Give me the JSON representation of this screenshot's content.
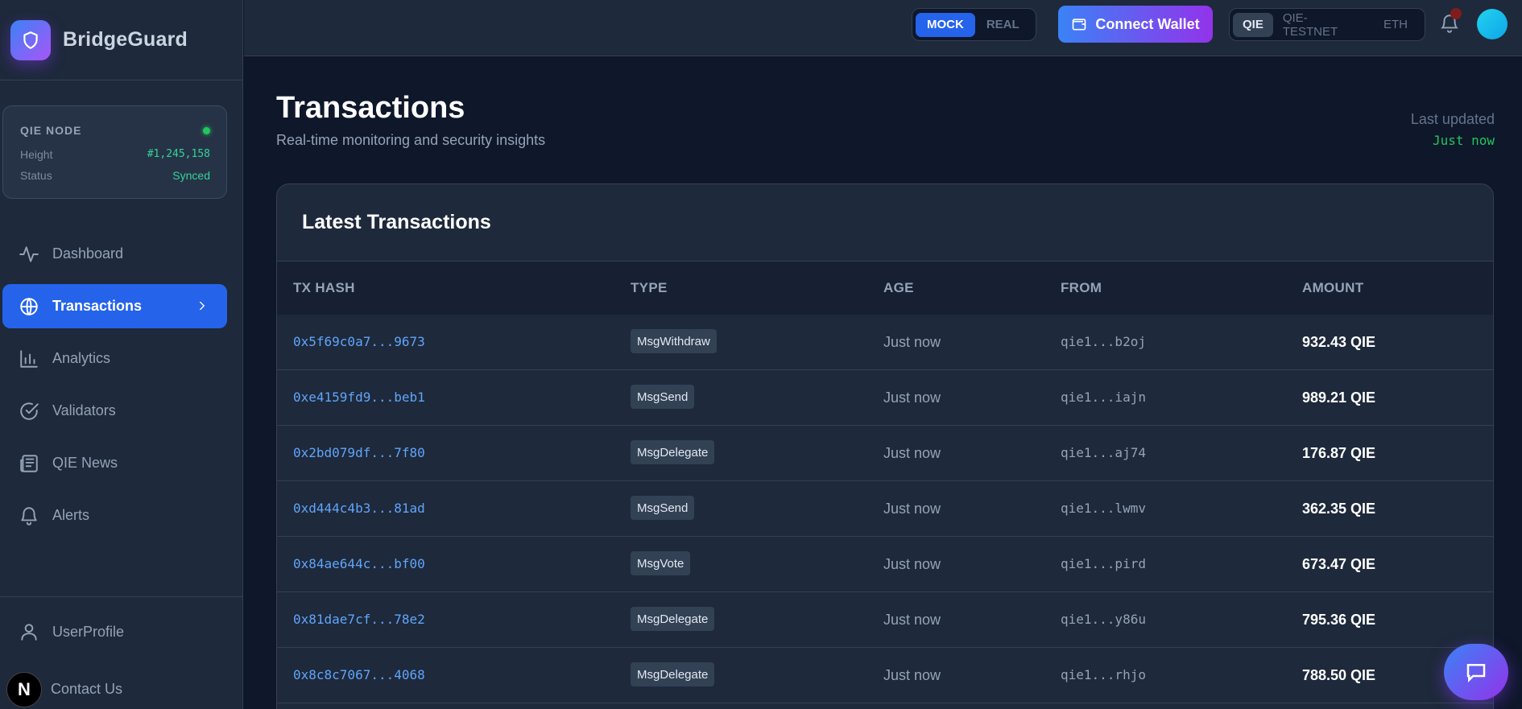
{
  "brand": {
    "name": "BridgeGuard"
  },
  "node": {
    "title": "QIE NODE",
    "height_label": "Height",
    "height_value": "#1,245,158",
    "status_label": "Status",
    "status_value": "Synced"
  },
  "nav": {
    "items": [
      {
        "label": "Dashboard",
        "icon": "activity-icon"
      },
      {
        "label": "Transactions",
        "icon": "globe-icon"
      },
      {
        "label": "Analytics",
        "icon": "bar-chart-icon"
      },
      {
        "label": "Validators",
        "icon": "check-circle-icon"
      },
      {
        "label": "QIE News",
        "icon": "newspaper-icon"
      },
      {
        "label": "Alerts",
        "icon": "bell-icon"
      }
    ],
    "active": "Transactions"
  },
  "sidebar_bottom": {
    "profile_label": "UserProfile",
    "contact_label": "Contact Us",
    "badge_letter": "N"
  },
  "topbar": {
    "mode_options": [
      "MOCK",
      "REAL"
    ],
    "mode_selected": "MOCK",
    "connect_label": "Connect Wallet",
    "network_options": [
      "QIE",
      "QIE-TESTNET",
      "ETH"
    ],
    "network_selected": "QIE"
  },
  "page": {
    "title": "Transactions",
    "subtitle": "Real-time monitoring and security insights",
    "last_updated_label": "Last updated",
    "last_updated_value": "Just now"
  },
  "table": {
    "title": "Latest Transactions",
    "columns": [
      "TX HASH",
      "TYPE",
      "AGE",
      "FROM",
      "AMOUNT"
    ],
    "rows": [
      {
        "hash": "0x5f69c0a7...9673",
        "type": "MsgWithdraw",
        "age": "Just now",
        "from": "qie1...b2oj",
        "amount": "932.43 QIE"
      },
      {
        "hash": "0xe4159fd9...beb1",
        "type": "MsgSend",
        "age": "Just now",
        "from": "qie1...iajn",
        "amount": "989.21 QIE"
      },
      {
        "hash": "0x2bd079df...7f80",
        "type": "MsgDelegate",
        "age": "Just now",
        "from": "qie1...aj74",
        "amount": "176.87 QIE"
      },
      {
        "hash": "0xd444c4b3...81ad",
        "type": "MsgSend",
        "age": "Just now",
        "from": "qie1...lwmv",
        "amount": "362.35 QIE"
      },
      {
        "hash": "0x84ae644c...bf00",
        "type": "MsgVote",
        "age": "Just now",
        "from": "qie1...pird",
        "amount": "673.47 QIE"
      },
      {
        "hash": "0x81dae7cf...78e2",
        "type": "MsgDelegate",
        "age": "Just now",
        "from": "qie1...y86u",
        "amount": "795.36 QIE"
      },
      {
        "hash": "0x8c8c7067...4068",
        "type": "MsgDelegate",
        "age": "Just now",
        "from": "qie1...rhjo",
        "amount": "788.50 QIE"
      }
    ]
  },
  "colors": {
    "accent": "#2563eb",
    "success": "#22c55e",
    "link": "#60a5fa",
    "gradient_start": "#3b82f6",
    "gradient_end": "#9333ea"
  }
}
